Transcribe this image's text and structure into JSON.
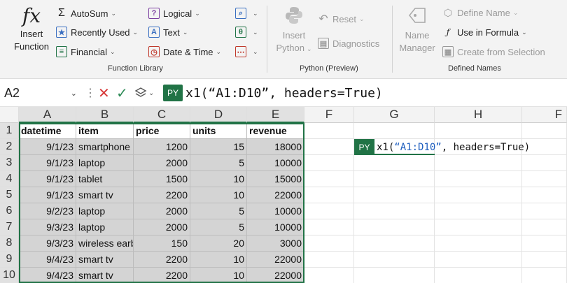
{
  "ribbon": {
    "function_library": {
      "label": "Function Library",
      "insert_function": {
        "icon": "fx",
        "line1": "Insert",
        "line2": "Function"
      },
      "autosum": "AutoSum",
      "recently_used": "Recently Used",
      "financial": "Financial",
      "logical": "Logical",
      "text": "Text",
      "date_time": "Date & Time"
    },
    "python_preview": {
      "label": "Python (Preview)",
      "insert_python": {
        "line1": "Insert",
        "line2": "Python"
      },
      "reset": "Reset",
      "diagnostics": "Diagnostics"
    },
    "defined_names": {
      "label": "Defined Names",
      "name_manager": {
        "line1": "Name",
        "line2": "Manager"
      },
      "define_name": "Define Name",
      "use_in_formula": "Use in Formula",
      "create_from_selection": "Create from Selection"
    }
  },
  "formula_bar": {
    "name_box": "A2",
    "py_badge": "PY",
    "formula": "x1(“A1:D10”, headers=True)"
  },
  "sheet": {
    "columns": [
      "A",
      "B",
      "C",
      "D",
      "E",
      "F",
      "G",
      "H",
      "F"
    ],
    "rows": [
      "1",
      "2",
      "3",
      "4",
      "5",
      "6",
      "7",
      "8",
      "9",
      "10"
    ],
    "table_headers": [
      "datetime",
      "item",
      "price",
      "units",
      "revenue"
    ],
    "table_rows": [
      [
        "9/1/23",
        "smartphone",
        "1200",
        "15",
        "18000"
      ],
      [
        "9/1/23",
        "laptop",
        "2000",
        "5",
        "10000"
      ],
      [
        "9/1/23",
        "tablet",
        "1500",
        "10",
        "15000"
      ],
      [
        "9/1/23",
        "smart tv",
        "2200",
        "10",
        "22000"
      ],
      [
        "9/2/23",
        "laptop",
        "2000",
        "5",
        "10000"
      ],
      [
        "9/3/23",
        "laptop",
        "2000",
        "5",
        "10000"
      ],
      [
        "9/3/23",
        "wireless earb",
        "150",
        "20",
        "3000"
      ],
      [
        "9/4/23",
        "smart tv",
        "2200",
        "10",
        "22000"
      ],
      [
        "9/4/23",
        "smart tv",
        "2200",
        "10",
        "22000"
      ]
    ],
    "python_cell": {
      "badge": "PY",
      "fn": "x1(",
      "arg": "“A1:D10”",
      "rest": ", headers=True)"
    }
  },
  "colors": {
    "accent": "#217346",
    "selection": "#d4d4d4",
    "string": "#1f5fbf"
  }
}
